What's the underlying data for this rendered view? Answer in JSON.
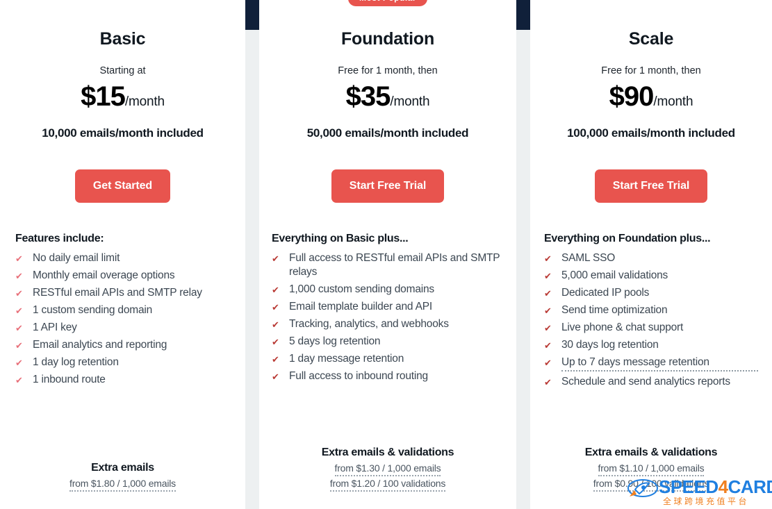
{
  "theme": {
    "accent_red": "#e8544e",
    "navy": "#10203a",
    "rail_gray": "#edf0f1",
    "check_light": "#e8707a",
    "check_dark": "#b93a35",
    "watermark_blue": "#1f7fe0",
    "watermark_orange": "#f08020"
  },
  "plans": [
    {
      "name": "Basic",
      "badge": "",
      "price_intro": "Starting at",
      "price_amount": "$15",
      "price_period": "/month",
      "included": "10,000 emails/month included",
      "cta_label": "Get Started",
      "features_heading": "Features include:",
      "features": [
        {
          "text": "No daily email limit",
          "underlined": false
        },
        {
          "text": "Monthly email overage options",
          "underlined": false
        },
        {
          "text": "RESTful email APIs and SMTP relay",
          "underlined": false
        },
        {
          "text": "1 custom sending domain",
          "underlined": false
        },
        {
          "text": "1 API key",
          "underlined": false
        },
        {
          "text": "Email analytics and reporting",
          "underlined": false
        },
        {
          "text": "1 day log retention",
          "underlined": false
        },
        {
          "text": "1 inbound route",
          "underlined": false
        }
      ],
      "extras_title": "Extra emails",
      "extras_lines": [
        "from $1.80 / 1,000 emails"
      ]
    },
    {
      "name": "Foundation",
      "badge": "Most Popular",
      "price_intro": "Free for 1 month, then",
      "price_amount": "$35",
      "price_period": "/month",
      "included": "50,000 emails/month included",
      "cta_label": "Start Free Trial",
      "features_heading": "Everything on Basic plus...",
      "features": [
        {
          "text": "Full access to RESTful email APIs and SMTP relays",
          "underlined": false
        },
        {
          "text": "1,000 custom sending domains",
          "underlined": false
        },
        {
          "text": "Email template builder and API",
          "underlined": false
        },
        {
          "text": "Tracking, analytics, and webhooks",
          "underlined": false
        },
        {
          "text": "5 days log retention",
          "underlined": false
        },
        {
          "text": "1 day message retention",
          "underlined": false
        },
        {
          "text": "Full access to inbound routing",
          "underlined": false
        }
      ],
      "extras_title": "Extra emails & validations",
      "extras_lines": [
        "from $1.30 / 1,000 emails",
        "from $1.20 / 100 validations"
      ]
    },
    {
      "name": "Scale",
      "badge": "",
      "price_intro": "Free for 1 month, then",
      "price_amount": "$90",
      "price_period": "/month",
      "included": "100,000 emails/month included",
      "cta_label": "Start Free Trial",
      "features_heading": "Everything on Foundation plus...",
      "features": [
        {
          "text": "SAML SSO",
          "underlined": false
        },
        {
          "text": "5,000 email validations",
          "underlined": false
        },
        {
          "text": "Dedicated IP pools",
          "underlined": false
        },
        {
          "text": "Send time optimization",
          "underlined": false
        },
        {
          "text": "Live phone & chat support",
          "underlined": false
        },
        {
          "text": "30 days log retention",
          "underlined": false
        },
        {
          "text": "Up to 7 days message retention",
          "underlined": true
        },
        {
          "text": "Schedule and send analytics reports",
          "underlined": false
        }
      ],
      "extras_title": "Extra emails & validations",
      "extras_lines": [
        "from $1.10 / 1,000 emails",
        "from $0.90 / 100 validations"
      ]
    }
  ],
  "watermark": {
    "text_part1": "SPEED",
    "text_part2": "4",
    "text_part3": "CARD",
    "subtitle": "全球跨境充值平台",
    "icon": "rocket-icon"
  }
}
